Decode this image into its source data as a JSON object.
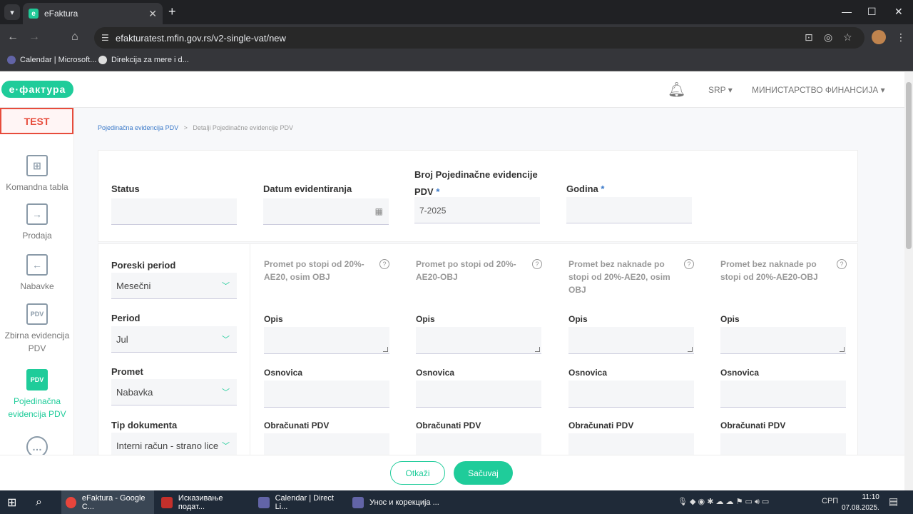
{
  "browser": {
    "tab_title": "eFaktura",
    "url": "efakturatest.mfin.gov.rs/v2-single-vat/new",
    "bookmarks": [
      "Calendar | Microsoft...",
      "Direkcija za mere i d..."
    ]
  },
  "header": {
    "logo": "e·фактура",
    "language": "SRP",
    "organization": "МИНИСТАРСТВО ФИНАНСИЈА"
  },
  "sidebar": {
    "test_badge": "TEST",
    "items": [
      {
        "label": "Komandna tabla"
      },
      {
        "label": "Prodaja"
      },
      {
        "label": "Nabavke"
      },
      {
        "label": "Zbirna evidencija PDV"
      },
      {
        "label": "Pojedinačna evidencija PDV"
      }
    ]
  },
  "breadcrumb": {
    "parent": "Pojedinačna evidencija PDV",
    "current": "Detalji Pojedinačne evidencije PDV"
  },
  "form_top": {
    "status_label": "Status",
    "status_value": "",
    "date_label": "Datum evidentiranja",
    "date_value": "",
    "number_label_line1": "Broj Pojedinačne evidencije",
    "number_label_line2": "PDV",
    "number_value": "7-2025",
    "year_label": "Godina",
    "year_value": "",
    "required_mark": "*"
  },
  "left_fields": {
    "tax_period_label": "Poreski period",
    "tax_period_value": "Mesečni",
    "period_label": "Period",
    "period_value": "Jul",
    "turnover_label": "Promet",
    "turnover_value": "Nabavka",
    "doc_type_label": "Tip dokumenta",
    "doc_type_value": "Interni račun - strano lice"
  },
  "columns": [
    {
      "title": "Promet po stopi od 20%-AE20, osim OBJ"
    },
    {
      "title": "Promet po stopi od 20%-AE20-OBJ"
    },
    {
      "title": "Promet bez naknade po stopi od 20%-AE20, osim OBJ"
    },
    {
      "title": "Promet bez naknade po stopi od 20%-AE20-OBJ"
    }
  ],
  "column_fields": {
    "description": "Opis",
    "base": "Osnovica",
    "vat": "Obračunati PDV",
    "help": "?"
  },
  "footer": {
    "cancel": "Otkaži",
    "save": "Sačuvaj"
  },
  "taskbar": {
    "items": [
      "eFaktura - Google C...",
      "Исказивање подат...",
      "Calendar | Direct Li...",
      "Унос и корекција ..."
    ],
    "lang": "СРП",
    "time": "11:10",
    "date": "07.08.2025."
  }
}
